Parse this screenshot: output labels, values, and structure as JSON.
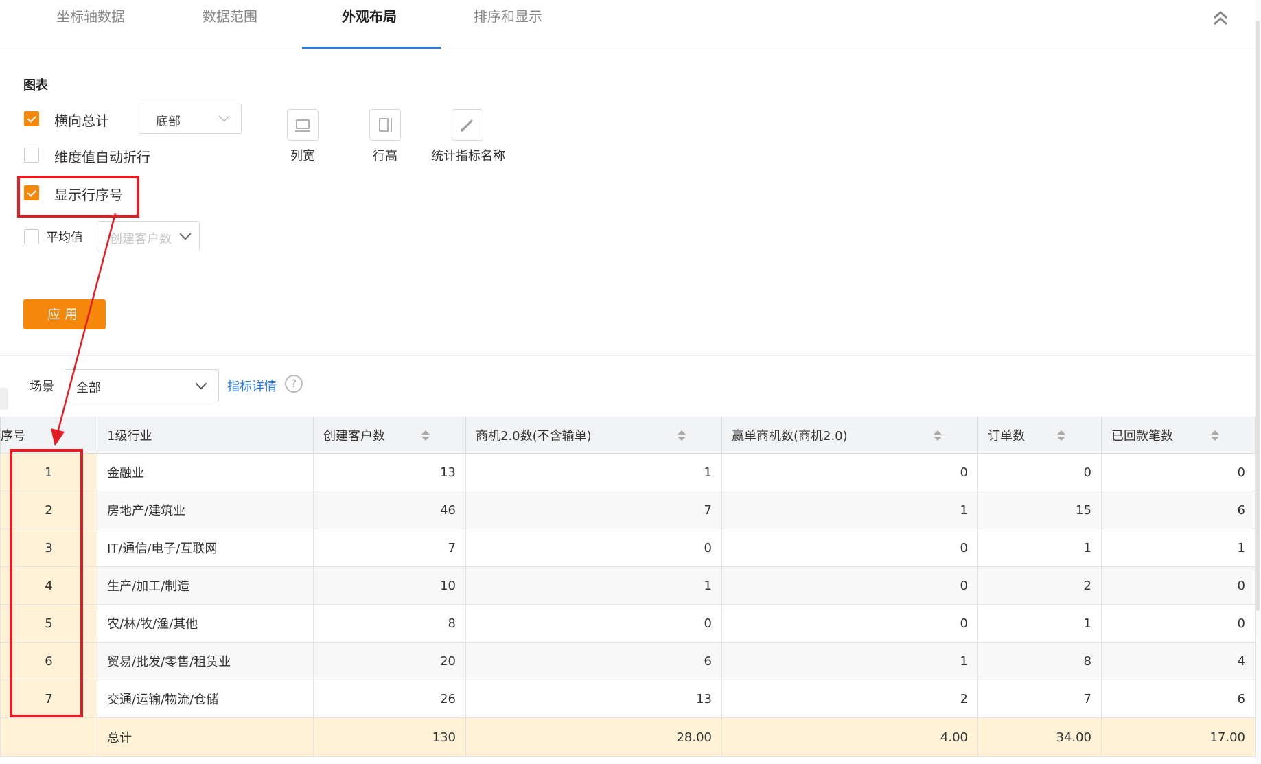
{
  "tabs": [
    {
      "label": "坐标轴数据",
      "active": false
    },
    {
      "label": "数据范围",
      "active": false
    },
    {
      "label": "外观布局",
      "active": true
    },
    {
      "label": "排序和显示",
      "active": false
    }
  ],
  "chart_section": {
    "title": "图表",
    "horizontal_total": {
      "label": "横向总计",
      "checked": true,
      "position_value": "底部"
    },
    "auto_wrap": {
      "label": "维度值自动折行",
      "checked": false
    },
    "show_row_number": {
      "label": "显示行序号",
      "checked": true
    },
    "average": {
      "label": "平均值",
      "checked": false,
      "placeholder": "创建客户数"
    },
    "tools": [
      {
        "label": "列宽",
        "icon": "column-width-icon"
      },
      {
        "label": "行高",
        "icon": "row-height-icon"
      },
      {
        "label": "统计指标名称",
        "icon": "pencil-icon"
      }
    ],
    "apply_label": "应用"
  },
  "filter": {
    "scene_label": "场景",
    "scene_value": "全部",
    "metric_detail_link": "指标详情",
    "help_icon": "?"
  },
  "table": {
    "columns": [
      "序号",
      "1级行业",
      "创建客户数",
      "商机2.0数(不含输单)",
      "赢单商机数(商机2.0)",
      "订单数",
      "已回款笔数"
    ],
    "rows": [
      [
        "1",
        "金融业",
        "13",
        "1",
        "0",
        "0",
        "0"
      ],
      [
        "2",
        "房地产/建筑业",
        "46",
        "7",
        "1",
        "15",
        "6"
      ],
      [
        "3",
        "IT/通信/电子/互联网",
        "7",
        "0",
        "0",
        "1",
        "1"
      ],
      [
        "4",
        "生产/加工/制造",
        "10",
        "1",
        "0",
        "2",
        "0"
      ],
      [
        "5",
        "农/林/牧/渔/其他",
        "8",
        "0",
        "0",
        "1",
        "0"
      ],
      [
        "6",
        "贸易/批发/零售/租赁业",
        "20",
        "6",
        "1",
        "8",
        "4"
      ],
      [
        "7",
        "交通/运输/物流/仓储",
        "26",
        "13",
        "2",
        "7",
        "6"
      ]
    ],
    "total": [
      "",
      "总计",
      "130",
      "28.00",
      "4.00",
      "34.00",
      "17.00"
    ]
  },
  "colors": {
    "accent": "#f5880a",
    "link": "#2d7ddf",
    "annotation": "#e31d24",
    "highlight_cell": "#fff2d6"
  }
}
